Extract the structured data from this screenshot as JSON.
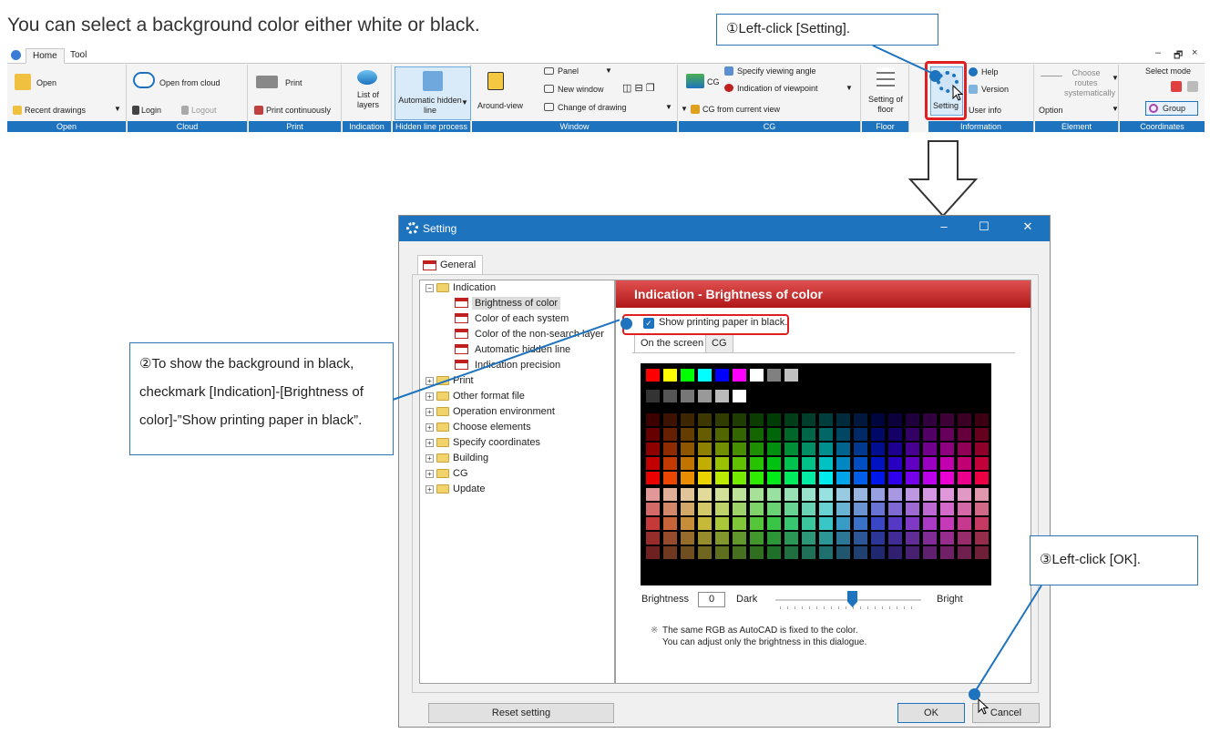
{
  "heading": "You can select a background color either white or black.",
  "callouts": {
    "step1": "①Left-click [Setting].",
    "step2_lines": [
      "②To show the background in black,",
      "checkmark [Indication]-[Brightness of",
      "color]-”Show printing paper in black”."
    ],
    "step3": "③Left-click [OK]."
  },
  "ribbon": {
    "tabs": [
      "Home",
      "Tool"
    ],
    "window_controls": [
      "–",
      "🗗",
      "×"
    ],
    "items": {
      "open": "Open",
      "recent": "Recent drawings",
      "open_cloud": "Open from cloud",
      "login": "Login",
      "logout": "Logout",
      "print": "Print",
      "print_cont": "Print continuously",
      "list_layers": "List of layers",
      "auto_hidden": "Automatic hidden line",
      "around": "Around-view",
      "panel": "Panel",
      "new_window": "New window",
      "change_drawing": "Change of drawing",
      "cg": "CG",
      "viewing_angle": "Specify viewing angle",
      "viewpoint": "Indication of viewpoint",
      "cg_current": "CG from current view",
      "setting_floor": "Setting of floor",
      "setting": "Setting",
      "help": "Help",
      "version": "Version",
      "user_info": "User info",
      "choose_routes": "Choose routes systematically",
      "option": "Option",
      "select_mode": "Select mode",
      "group": "Group"
    },
    "groups": [
      "Open",
      "Cloud",
      "Print",
      "Indication",
      "Hidden line process",
      "Window",
      "CG",
      "Floor",
      "Information",
      "Element",
      "Coordinates"
    ]
  },
  "dialog": {
    "title": "Setting",
    "tab": "General",
    "tree": {
      "indication": "Indication",
      "children": [
        "Brightness of color",
        "Color of each system",
        "Color of the non-search layer",
        "Automatic hidden line",
        "Indication precision"
      ],
      "others": [
        "Print",
        "Other format file",
        "Operation environment",
        "Choose elements",
        "Specify coordinates",
        "Building",
        "CG",
        "Update"
      ]
    },
    "panel_title": "Indication - Brightness of color",
    "checkbox_label": "Show printing paper in black.",
    "subtabs": [
      "On the screen",
      "CG"
    ],
    "brightness_label": "Brightness",
    "brightness_value": "0",
    "dark_label": "Dark",
    "bright_label": "Bright",
    "brightness_level": 0.5,
    "note_mark": "※",
    "note_lines": [
      "The same RGB as AutoCAD is fixed to the color.",
      "You can adjust only the brightness in this dialogue."
    ],
    "reset_button": "Reset setting",
    "ok_button": "OK",
    "cancel_button": "Cancel"
  },
  "colors": {
    "accent": "#1e73be",
    "highlight": "#e02020",
    "panel_header": "#c42020"
  }
}
